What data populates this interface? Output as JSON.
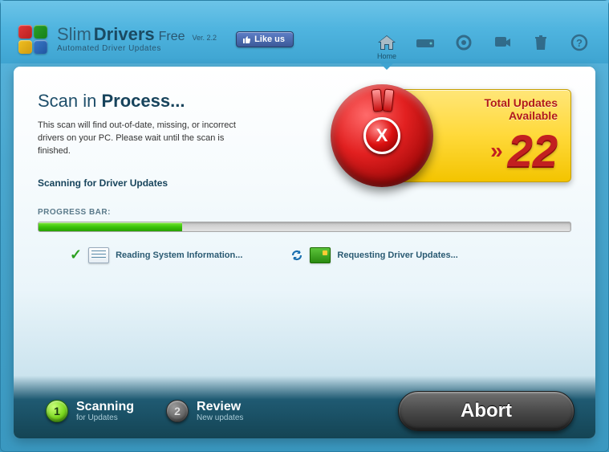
{
  "window": {
    "minimize": "—",
    "close": "×"
  },
  "brand": {
    "slim": "Slim",
    "drivers": "Drivers",
    "free": "Free",
    "ver": "Ver. 2.2",
    "sub": "Automated Driver Updates"
  },
  "like": {
    "label": "Like us"
  },
  "nav": {
    "home": "Home"
  },
  "scan": {
    "title_a": "Scan in ",
    "title_b": "Process...",
    "desc": "This scan will find out-of-date, missing, or incorrect drivers on your PC.  Please wait until the scan is finished.",
    "status": "Scanning for Driver Updates"
  },
  "updates": {
    "title": "Total Updates Available",
    "count": "22",
    "chev": "»"
  },
  "progress": {
    "label": "PROGRESS BAR:",
    "percent": 27
  },
  "tasks": {
    "a": "Reading System Information...",
    "b": "Requesting Driver Updates..."
  },
  "steps": {
    "s1_num": "1",
    "s1_title": "Scanning",
    "s1_sub": "for Updates",
    "s2_num": "2",
    "s2_title": "Review",
    "s2_sub": "New updates"
  },
  "abort": {
    "label": "Abort"
  }
}
